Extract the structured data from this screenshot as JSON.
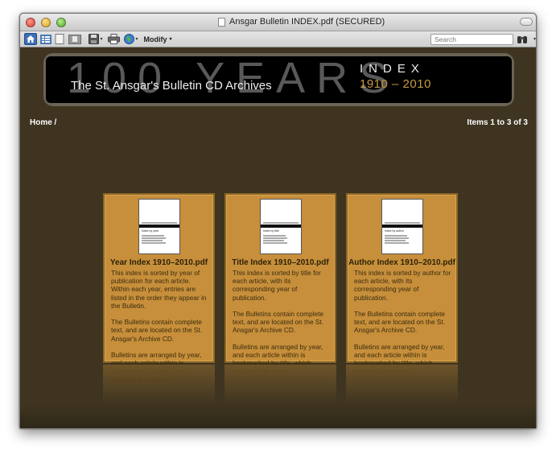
{
  "window": {
    "title": "Ansgar Bulletin INDEX.pdf (SECURED)"
  },
  "toolbar": {
    "modify_label": "Modify",
    "search_placeholder": "Search"
  },
  "banner": {
    "big_text": "100 YEARS",
    "subtitle": "The St. Ansgar's Bulletin CD Archives",
    "index_word": "INDEX",
    "years": "1910 – 2010",
    "years_color": "#c79a42"
  },
  "nav": {
    "breadcrumb": "Home /",
    "items_count": "Items 1 to 3 of 3"
  },
  "cards": [
    {
      "title": "Year Index 1910–2010.pdf",
      "thumb_label": "Index by year",
      "description": "This index is sorted by year of publication for each article. Within each year, entries are listed in the order they appear in the Bulletin.\n\nThe Bulletins contain complete text, and are located on the St. Ansgar's Archive CD.\n\nBulletins are arranged by year, and each article within is bookmarked by title, which matches this index."
    },
    {
      "title": "Title Index 1910–2010.pdf",
      "thumb_label": "Index by title",
      "description": "This index is sorted by title for each article, with its corresponding year of publication.\n\nThe Bulletins contain complete text, and are located on the St. Ansgar's Archive CD.\n\nBulletins are arranged by year, and each article within is bookmarked by title, which matches this index."
    },
    {
      "title": "Author Index 1910–2010.pdf",
      "thumb_label": "Index by author",
      "description": "This index is sorted by author for each article, with its corresponding year of publication.\n\nThe Bulletins contain complete text, and are located on the St. Ansgar's Archive CD.\n\nBulletins are arranged by year, and each article within is bookmarked by title, which matches this index."
    }
  ],
  "colors": {
    "background": "#3e3420",
    "card": "#c78f3b",
    "card_border": "#8b6624"
  }
}
